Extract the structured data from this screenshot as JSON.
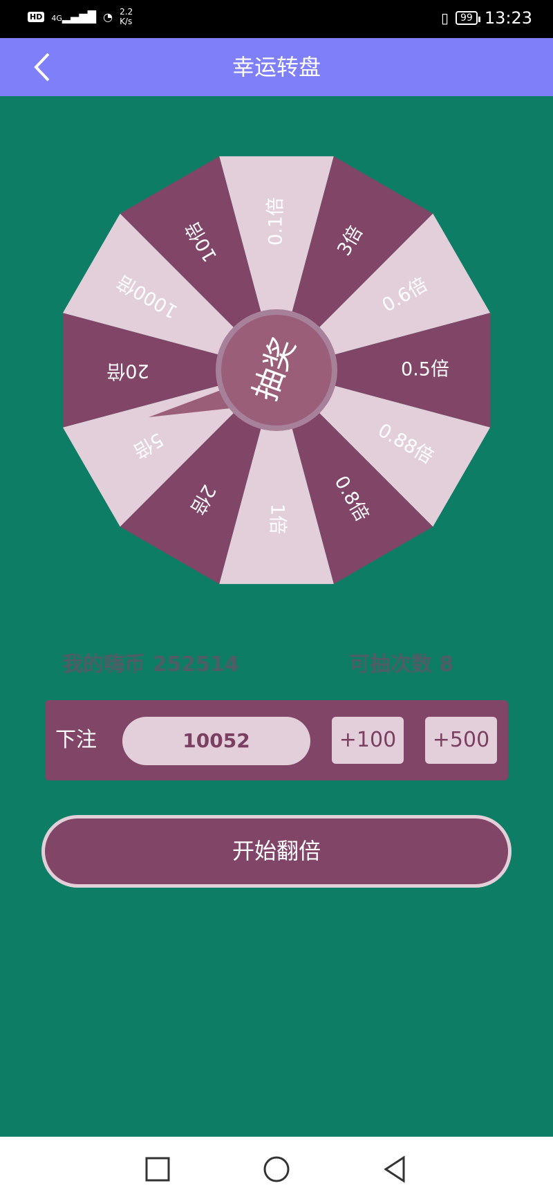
{
  "status_bar": {
    "hd": "HD",
    "signal": "4G",
    "speed_line1": "2.2",
    "speed_line2": "K/s",
    "battery": "99",
    "time": "13:23"
  },
  "header": {
    "title": "幸运转盘"
  },
  "wheel": {
    "center_label": "抽奖",
    "segments": [
      "0.1倍",
      "3倍",
      "0.6倍",
      "0.5倍",
      "0.88倍",
      "0.8倍",
      "1倍",
      "2倍",
      "5倍",
      "20倍",
      "1000倍",
      "10倍"
    ],
    "colors": {
      "light": "#e3cfd9",
      "dark": "#814568",
      "hub": "#9a5e78",
      "hub_ring": "#a7819a"
    }
  },
  "info": {
    "coins_text": "我的嗨币 252514",
    "draws_text": "可抽次数 8"
  },
  "bet": {
    "label": "下注",
    "amount": "10052",
    "add_100": "+100",
    "add_500": "+500"
  },
  "start_button": {
    "label": "开始翻倍"
  }
}
